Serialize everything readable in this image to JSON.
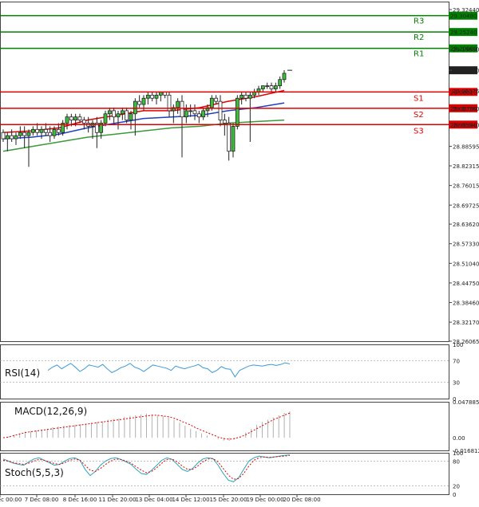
{
  "chart_data": [
    {
      "type": "candlestick",
      "name": "price",
      "y_ticks": [
        "29.32440",
        "29.19800",
        "29.12970",
        "29.06375",
        "29.00780",
        "28.95540",
        "28.88595",
        "28.82315",
        "28.76015",
        "28.69725",
        "28.63620",
        "28.57330",
        "28.51040",
        "28.44750",
        "28.38460",
        "28.32170",
        "28.26065"
      ],
      "x_ticks": [
        "6 Dec 00:00",
        "7 Dec 08:00",
        "8 Dec 16:00",
        "11 Dec 20:00",
        "13 Dec 04:00",
        "14 Dec 12:00",
        "15 Dec 20:00",
        "19 Dec 00:00",
        "20 Dec 08:00"
      ],
      "ylim": [
        28.26065,
        29.35
      ],
      "levels": [
        {
          "label": "R3",
          "value": "29.30480",
          "color": "#008000"
        },
        {
          "label": "R2",
          "value": "29.25240",
          "color": "#008000"
        },
        {
          "label": "R1",
          "value": "29.20000",
          "color": "#008000"
        },
        {
          "label": "S1",
          "value": "29.06020",
          "color": "#e00000"
        },
        {
          "label": "S2",
          "value": "29.00780",
          "color": "#e00000"
        },
        {
          "label": "S3",
          "value": "28.95540",
          "color": "#e00000"
        }
      ],
      "current_price": "29.12970",
      "candles": [
        [
          28.93,
          28.94,
          28.9,
          28.91
        ],
        [
          28.91,
          28.93,
          28.87,
          28.92
        ],
        [
          28.92,
          28.94,
          28.9,
          28.91
        ],
        [
          28.91,
          28.93,
          28.89,
          28.92
        ],
        [
          28.92,
          28.95,
          28.91,
          28.93
        ],
        [
          28.93,
          28.95,
          28.88,
          28.92
        ],
        [
          28.92,
          28.94,
          28.82,
          28.93
        ],
        [
          28.93,
          28.95,
          28.92,
          28.94
        ],
        [
          28.94,
          28.96,
          28.92,
          28.93
        ],
        [
          28.93,
          28.95,
          28.91,
          28.94
        ],
        [
          28.94,
          28.96,
          28.92,
          28.93
        ],
        [
          28.93,
          28.95,
          28.9,
          28.92
        ],
        [
          28.92,
          28.95,
          28.91,
          28.94
        ],
        [
          28.94,
          28.96,
          28.92,
          28.93
        ],
        [
          28.93,
          28.97,
          28.92,
          28.96
        ],
        [
          28.96,
          28.99,
          28.94,
          28.98
        ],
        [
          28.98,
          28.99,
          28.95,
          28.97
        ],
        [
          28.97,
          28.99,
          28.95,
          28.98
        ],
        [
          28.98,
          28.99,
          28.96,
          28.97
        ],
        [
          28.97,
          28.98,
          28.94,
          28.96
        ],
        [
          28.96,
          28.98,
          28.93,
          28.95
        ],
        [
          28.95,
          28.97,
          28.91,
          28.96
        ],
        [
          28.96,
          28.98,
          28.88,
          28.93
        ],
        [
          28.93,
          28.97,
          28.91,
          28.96
        ],
        [
          28.96,
          29.0,
          28.95,
          28.99
        ],
        [
          28.99,
          29.01,
          28.97,
          29.0
        ],
        [
          29.0,
          29.01,
          28.96,
          28.98
        ],
        [
          28.98,
          29.0,
          28.94,
          28.99
        ],
        [
          28.99,
          29.01,
          28.97,
          29.0
        ],
        [
          29.0,
          29.01,
          28.96,
          28.97
        ],
        [
          28.97,
          29.0,
          28.94,
          28.99
        ],
        [
          28.99,
          29.04,
          28.92,
          29.03
        ],
        [
          29.03,
          29.05,
          29.01,
          29.02
        ],
        [
          29.02,
          29.05,
          29.0,
          29.04
        ],
        [
          29.04,
          29.06,
          29.02,
          29.05
        ],
        [
          29.05,
          29.06,
          29.03,
          29.04
        ],
        [
          29.04,
          29.06,
          29.02,
          29.05
        ],
        [
          29.05,
          29.06,
          29.03,
          29.06
        ],
        [
          29.06,
          29.06,
          29.04,
          29.05
        ],
        [
          29.05,
          29.06,
          28.98,
          29.0
        ],
        [
          29.0,
          29.02,
          28.96,
          29.01
        ],
        [
          29.01,
          29.04,
          28.99,
          29.03
        ],
        [
          29.03,
          29.05,
          28.85,
          28.98
        ],
        [
          28.98,
          29.02,
          28.96,
          29.0
        ],
        [
          29.0,
          29.02,
          28.98,
          29.0
        ],
        [
          29.0,
          29.02,
          28.97,
          28.99
        ],
        [
          28.99,
          29.0,
          28.96,
          28.98
        ],
        [
          28.98,
          29.01,
          28.97,
          29.0
        ],
        [
          29.0,
          29.02,
          28.98,
          29.01
        ],
        [
          29.01,
          29.05,
          29.0,
          29.04
        ],
        [
          29.04,
          29.05,
          29.02,
          29.03
        ],
        [
          29.03,
          29.05,
          28.95,
          28.97
        ],
        [
          28.97,
          28.99,
          28.92,
          28.96
        ],
        [
          28.96,
          28.98,
          28.84,
          28.87
        ],
        [
          28.87,
          28.96,
          28.85,
          28.95
        ],
        [
          28.95,
          29.05,
          28.94,
          29.04
        ],
        [
          29.04,
          29.06,
          29.02,
          29.05
        ],
        [
          29.05,
          29.06,
          29.03,
          29.04
        ],
        [
          29.04,
          29.06,
          28.9,
          29.05
        ],
        [
          29.05,
          29.07,
          29.04,
          29.06
        ],
        [
          29.06,
          29.08,
          29.05,
          29.07
        ],
        [
          29.07,
          29.08,
          29.06,
          29.08
        ],
        [
          29.08,
          29.09,
          29.07,
          29.08
        ],
        [
          29.08,
          29.09,
          29.06,
          29.07
        ],
        [
          29.07,
          29.09,
          29.06,
          29.08
        ],
        [
          29.08,
          29.11,
          29.07,
          29.1
        ],
        [
          29.1,
          29.13,
          29.09,
          29.12
        ]
      ],
      "ma_red": [
        [
          0,
          28.93
        ],
        [
          0.1,
          28.935
        ],
        [
          0.2,
          28.945
        ],
        [
          0.3,
          28.97
        ],
        [
          0.4,
          28.985
        ],
        [
          0.5,
          29.0
        ],
        [
          0.6,
          29.0
        ],
        [
          0.7,
          29.01
        ],
        [
          0.8,
          29.03
        ],
        [
          0.9,
          29.045
        ],
        [
          1.0,
          29.065
        ]
      ],
      "ma_blue": [
        [
          0,
          28.91
        ],
        [
          0.1,
          28.915
        ],
        [
          0.2,
          28.925
        ],
        [
          0.3,
          28.945
        ],
        [
          0.4,
          28.96
        ],
        [
          0.5,
          28.975
        ],
        [
          0.6,
          28.98
        ],
        [
          0.7,
          28.985
        ],
        [
          0.8,
          29.0
        ],
        [
          0.9,
          29.01
        ],
        [
          1.0,
          29.025
        ]
      ],
      "ma_green": [
        [
          0,
          28.87
        ],
        [
          0.1,
          28.885
        ],
        [
          0.2,
          28.9
        ],
        [
          0.3,
          28.915
        ],
        [
          0.4,
          28.925
        ],
        [
          0.5,
          28.935
        ],
        [
          0.6,
          28.945
        ],
        [
          0.7,
          28.95
        ],
        [
          0.8,
          28.96
        ],
        [
          0.9,
          28.965
        ],
        [
          1.0,
          28.97
        ]
      ],
      "ma_colors": {
        "red": "#e00000",
        "blue": "#2040c0",
        "green": "#3a9a3a"
      }
    },
    {
      "type": "line",
      "name": "RSI",
      "title": "RSI(14)",
      "y_ticks": [
        "100",
        "70",
        "30",
        "0"
      ],
      "levels": [
        70,
        30
      ],
      "ylim": [
        0,
        100
      ],
      "color": "#3a9ad9",
      "values": [
        52,
        58,
        62,
        55,
        60,
        65,
        58,
        50,
        55,
        62,
        60,
        58,
        63,
        55,
        48,
        52,
        57,
        60,
        65,
        58,
        55,
        50,
        56,
        62,
        60,
        58,
        56,
        52,
        60,
        57,
        55,
        58,
        60,
        63,
        57,
        55,
        48,
        52,
        59,
        55,
        54,
        40,
        52,
        56,
        60,
        62,
        61,
        60,
        62,
        63,
        61,
        63,
        66,
        64
      ]
    },
    {
      "type": "bar",
      "name": "MACD",
      "title": "MACD(12,26,9)",
      "y_ticks": [
        "0.047885",
        "0.00",
        "-0.016812"
      ],
      "ylim": [
        -0.016812,
        0.047885
      ],
      "bar_color": "#b0b0b0",
      "signal_color": "#e00000",
      "values": [
        0.0,
        0.002,
        0.004,
        0.006,
        0.008,
        0.009,
        0.01,
        0.011,
        0.012,
        0.014,
        0.015,
        0.016,
        0.017,
        0.017,
        0.018,
        0.019,
        0.02,
        0.021,
        0.022,
        0.024,
        0.025,
        0.026,
        0.028,
        0.029,
        0.03,
        0.031,
        0.032,
        0.031,
        0.03,
        0.029,
        0.027,
        0.024,
        0.02,
        0.016,
        0.012,
        0.009,
        0.006,
        0.003,
        0.0,
        -0.002,
        -0.004,
        -0.004,
        -0.002,
        0.002,
        0.007,
        0.012,
        0.017,
        0.021,
        0.024,
        0.027,
        0.03,
        0.033,
        0.035
      ],
      "signal": [
        0.0,
        0.001,
        0.003,
        0.005,
        0.007,
        0.008,
        0.009,
        0.01,
        0.011,
        0.012,
        0.013,
        0.014,
        0.015,
        0.016,
        0.017,
        0.018,
        0.019,
        0.02,
        0.021,
        0.022,
        0.023,
        0.024,
        0.025,
        0.026,
        0.027,
        0.028,
        0.029,
        0.03,
        0.03,
        0.029,
        0.028,
        0.026,
        0.023,
        0.02,
        0.017,
        0.013,
        0.01,
        0.007,
        0.004,
        0.001,
        -0.001,
        -0.002,
        -0.001,
        0.001,
        0.004,
        0.008,
        0.012,
        0.016,
        0.02,
        0.024,
        0.027,
        0.03,
        0.033
      ]
    },
    {
      "type": "line",
      "name": "Stochastic",
      "title": "Stoch(5,5,3)",
      "y_ticks": [
        "100",
        "80",
        "20",
        "0"
      ],
      "levels": [
        80,
        20
      ],
      "ylim": [
        0,
        100
      ],
      "main_color": "#2aa5b8",
      "signal_color": "#e00000",
      "main": [
        85,
        80,
        75,
        72,
        70,
        78,
        85,
        88,
        82,
        76,
        70,
        72,
        80,
        86,
        88,
        82,
        60,
        45,
        55,
        70,
        80,
        86,
        88,
        84,
        78,
        72,
        60,
        50,
        48,
        58,
        70,
        82,
        88,
        84,
        72,
        60,
        55,
        62,
        75,
        85,
        88,
        86,
        70,
        50,
        34,
        30,
        40,
        60,
        80,
        88,
        92,
        90,
        88,
        90,
        92,
        94,
        95
      ],
      "signal": [
        82,
        80,
        76,
        74,
        72,
        75,
        80,
        84,
        82,
        78,
        74,
        72,
        76,
        82,
        85,
        82,
        70,
        58,
        55,
        62,
        72,
        80,
        85,
        84,
        80,
        75,
        66,
        58,
        52,
        55,
        64,
        75,
        84,
        85,
        78,
        68,
        60,
        60,
        68,
        78,
        85,
        86,
        78,
        62,
        46,
        36,
        38,
        50,
        68,
        82,
        88,
        90,
        89,
        90,
        91,
        92,
        94
      ]
    }
  ]
}
